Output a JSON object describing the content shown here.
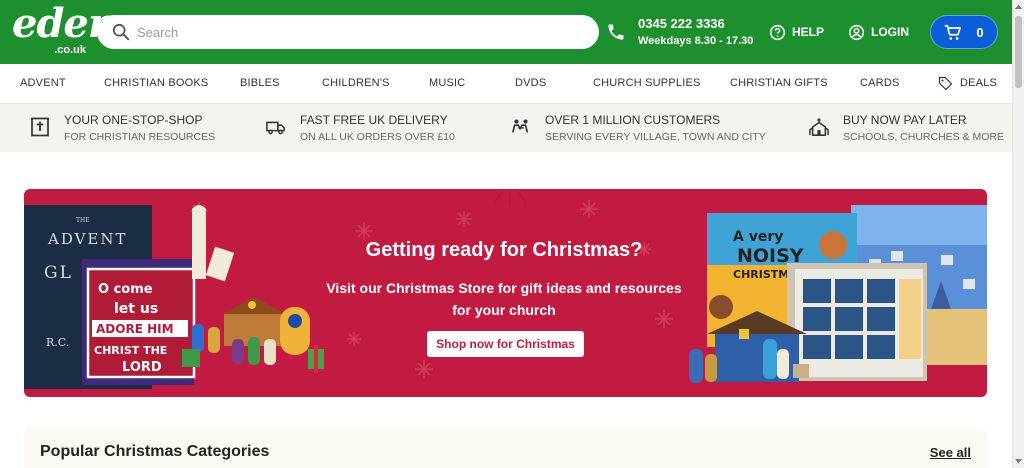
{
  "header": {
    "logo_word": "eden",
    "logo_tld": ".co.uk",
    "search_placeholder": "Search",
    "phone_number": "0345 222 3336",
    "phone_hours": "Weekdays 8.30 - 17.30",
    "help_label": "HELP",
    "login_label": "LOGIN",
    "cart_count": "0",
    "brand_color": "#1e8f2e",
    "cart_color": "#0b5ed7"
  },
  "nav": {
    "items": [
      "ADVENT",
      "CHRISTIAN BOOKS",
      "BIBLES",
      "CHILDREN'S",
      "MUSIC",
      "DVDS",
      "CHURCH SUPPLIES",
      "CHRISTIAN GIFTS",
      "CARDS",
      "DEALS"
    ]
  },
  "usp": {
    "items": [
      {
        "title": "YOUR ONE-STOP-SHOP",
        "subtitle": "FOR CHRISTIAN RESOURCES",
        "icon": "bible-icon"
      },
      {
        "title": "FAST FREE UK DELIVERY",
        "subtitle": "ON ALL UK ORDERS OVER £10",
        "icon": "truck-icon"
      },
      {
        "title": "OVER 1 MILLION CUSTOMERS",
        "subtitle": "SERVING EVERY VILLAGE, TOWN AND CITY",
        "icon": "people-icon"
      },
      {
        "title": "BUY NOW PAY LATER",
        "subtitle": "SCHOOLS, CHURCHES & MORE",
        "icon": "church-icon"
      }
    ]
  },
  "hero": {
    "title": "Getting ready for Christmas?",
    "subtitle": "Visit our Christmas Store for gift ideas and resources for your church",
    "button_label": "Shop now for Christmas",
    "book_title_left": "ADVENT",
    "book_title_left_2": "GL",
    "book_author_left": "R.C.",
    "banner_text_1": "O come",
    "banner_text_2": "let us",
    "banner_text_3": "ADORE HIM",
    "banner_text_4": "CHRIST THE",
    "banner_text_5": "LORD",
    "book_title_right_1": "A very",
    "book_title_right_2": "NOISY",
    "book_title_right_3": "CHRISTMAS",
    "background_color": "#c21b42"
  },
  "popular": {
    "title": "Popular Christmas Categories",
    "see_all": "See all"
  }
}
